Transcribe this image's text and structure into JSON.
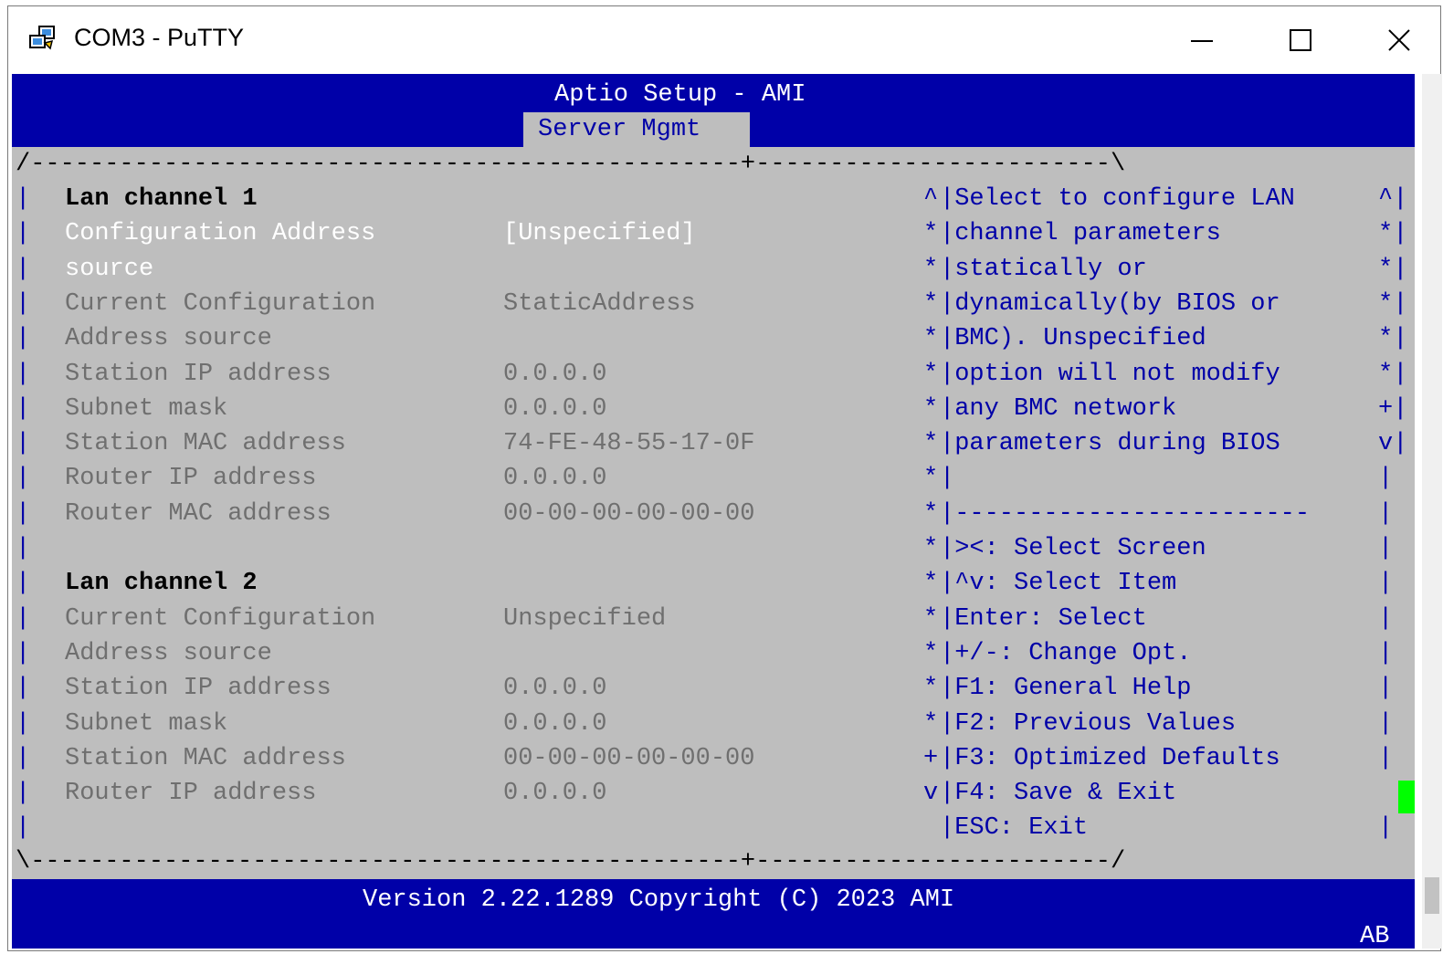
{
  "window": {
    "title": "COM3 - PuTTY",
    "icons": {
      "app": "putty-icon",
      "minimize": "minimize-icon",
      "maximize": "maximize-icon",
      "close": "close-icon"
    }
  },
  "bios": {
    "header": "Aptio Setup - AMI",
    "active_tab": "Server Mgmt",
    "border_top": "/------------------------------------------------+------------------------\\",
    "border_bottom": "\\------------------------------------------------+------------------------/",
    "rows": [
      {
        "lb": "|",
        "label": "Lan channel 1",
        "value": "",
        "mk": "^",
        "help": "|Select to configure LAN",
        "rb": "^|"
      },
      {
        "lb": "|",
        "label": "Configuration Address",
        "value": "[Unspecified]",
        "mk": "*",
        "help": "|channel parameters",
        "rb": "*|"
      },
      {
        "lb": "|",
        "label": "source",
        "value": "",
        "mk": "*",
        "help": "|statically or",
        "rb": "*|"
      },
      {
        "lb": "|",
        "label": "Current Configuration",
        "value": "StaticAddress",
        "mk": "*",
        "help": "|dynamically(by BIOS or",
        "rb": "*|"
      },
      {
        "lb": "|",
        "label": "Address source",
        "value": "",
        "mk": "*",
        "help": "|BMC). Unspecified",
        "rb": "*|"
      },
      {
        "lb": "|",
        "label": "Station IP address",
        "value": "0.0.0.0",
        "mk": "*",
        "help": "|option will not modify",
        "rb": "*|"
      },
      {
        "lb": "|",
        "label": "Subnet mask",
        "value": "0.0.0.0",
        "mk": "*",
        "help": "|any BMC network",
        "rb": "+|"
      },
      {
        "lb": "|",
        "label": "Station MAC address",
        "value": "74-FE-48-55-17-0F",
        "mk": "*",
        "help": "|parameters during BIOS",
        "rb": "v|"
      },
      {
        "lb": "|",
        "label": "Router IP address",
        "value": "0.0.0.0",
        "mk": "*",
        "help": "|",
        "rb": "|"
      },
      {
        "lb": "|",
        "label": "Router MAC address",
        "value": "00-00-00-00-00-00",
        "mk": "*",
        "help": "|------------------------",
        "rb": "|"
      },
      {
        "lb": "|",
        "label": "",
        "value": "",
        "mk": "*",
        "help": "|><: Select Screen",
        "rb": "|"
      },
      {
        "lb": "|",
        "label": "Lan channel 2",
        "value": "",
        "mk": "*",
        "help": "|^v: Select Item",
        "rb": "|"
      },
      {
        "lb": "|",
        "label": "Current Configuration",
        "value": "Unspecified",
        "mk": "*",
        "help": "|Enter: Select",
        "rb": "|"
      },
      {
        "lb": "|",
        "label": "Address source",
        "value": "",
        "mk": "*",
        "help": "|+/-: Change Opt.",
        "rb": "|"
      },
      {
        "lb": "|",
        "label": "Station IP address",
        "value": "0.0.0.0",
        "mk": "*",
        "help": "|F1: General Help",
        "rb": "|"
      },
      {
        "lb": "|",
        "label": "Subnet mask",
        "value": "0.0.0.0",
        "mk": "*",
        "help": "|F2: Previous Values",
        "rb": "|"
      },
      {
        "lb": "|",
        "label": "Station MAC address",
        "value": "00-00-00-00-00-00",
        "mk": "+",
        "help": "|F3: Optimized Defaults",
        "rb": "|"
      },
      {
        "lb": "|",
        "label": "Router IP address",
        "value": "0.0.0.0",
        "mk": "v",
        "help": "|F4: Save & Exit",
        "rb": ""
      },
      {
        "lb": "|",
        "label": "",
        "value": "",
        "mk": "",
        "help": "|ESC: Exit",
        "rb": "|"
      }
    ],
    "footer": "Version 2.22.1289 Copyright (C) 2023 AMI",
    "status_indicator": "AB",
    "colors": {
      "band": "#0000a8",
      "panel": "#bebebe",
      "selected_text": "#ffffff",
      "item_text": "#6f6f6f",
      "help_text": "#0000a8",
      "cursor": "#00ff00"
    }
  }
}
